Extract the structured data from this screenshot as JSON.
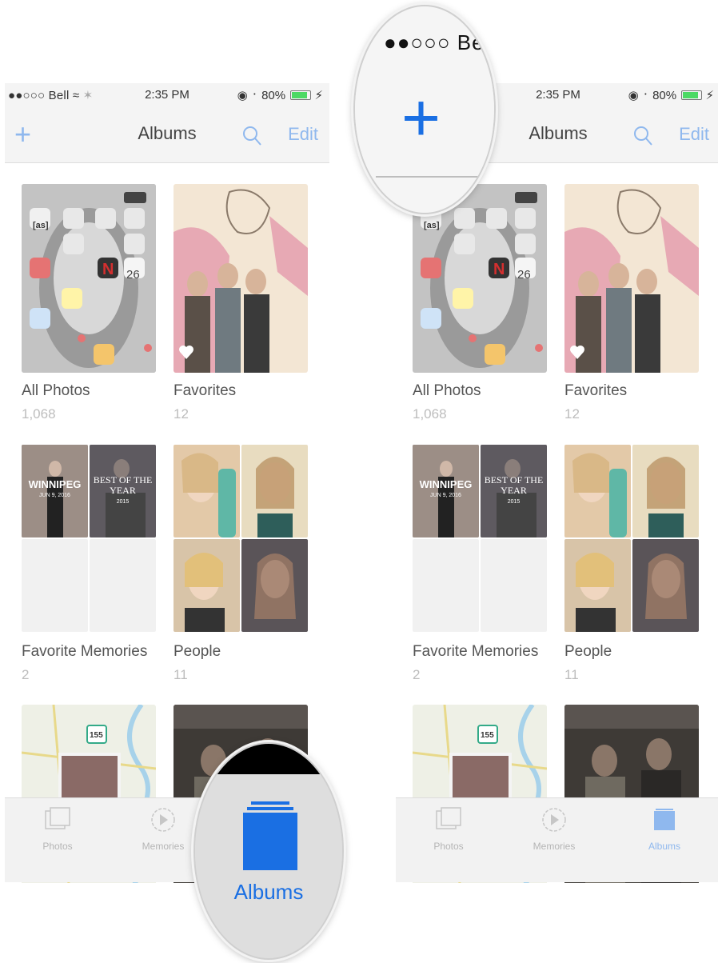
{
  "status_bar": {
    "carrier": "●●○○○ Bell",
    "time": "2:35 PM",
    "battery": "80%"
  },
  "nav": {
    "title": "Albums",
    "add_label": "+",
    "edit_label": "Edit"
  },
  "albums": [
    {
      "name": "All Photos",
      "count": "1,068"
    },
    {
      "name": "Favorites",
      "count": "12"
    },
    {
      "name": "Favorite Memories",
      "count": "2"
    },
    {
      "name": "People",
      "count": "11"
    }
  ],
  "memory_cards": [
    {
      "title": "WINNIPEG",
      "date": "JUN 9, 2016"
    },
    {
      "title": "BEST OF THE YEAR",
      "date": "2015"
    }
  ],
  "map_marker": "155",
  "home_screen_icon_text": "[as]",
  "calendar_day": "26",
  "tabs": [
    {
      "label": "Photos"
    },
    {
      "label": "Memories"
    },
    {
      "label": "Albums"
    }
  ],
  "magnifier_top": {
    "carrier": "●●○○○ Be",
    "add_label": "+"
  },
  "magnifier_bottom": {
    "label": "Albums"
  },
  "colors": {
    "ios_blue": "#1a6fe3",
    "ios_blue_faded": "#8fb8ee",
    "battery_green": "#4cd964"
  }
}
